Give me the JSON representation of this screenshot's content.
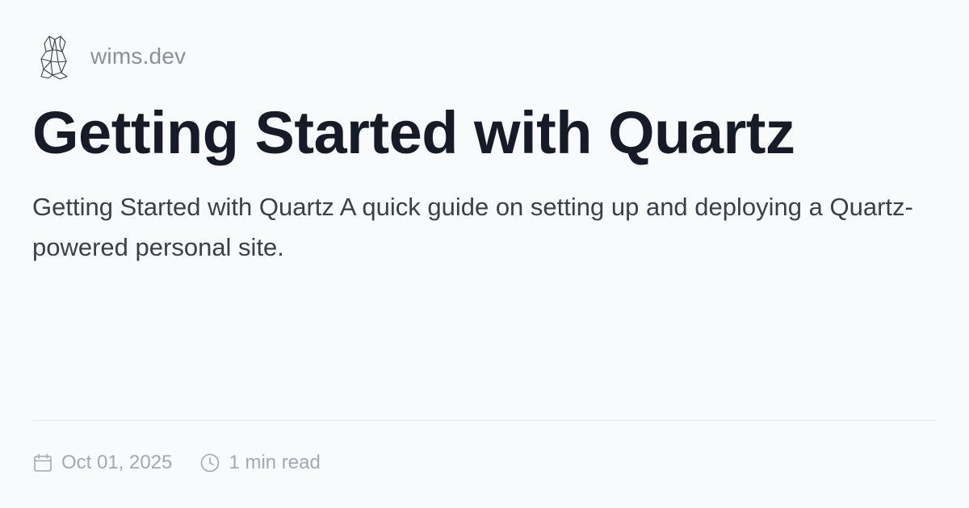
{
  "site": {
    "name": "wims.dev",
    "logo_icon": "crystal-logo-icon"
  },
  "post": {
    "title": "Getting Started with Quartz",
    "description": "Getting Started with Quartz A quick guide on setting up and deploying a Quartz-powered personal site.",
    "date": "Oct 01, 2025",
    "date_icon": "calendar-icon",
    "read_time": "1 min read",
    "read_time_icon": "clock-icon"
  },
  "colors": {
    "background": "#f9fafc",
    "title": "#161b27",
    "description": "#3a3f48",
    "muted": "#8a8f98",
    "meta": "#a3a8b1",
    "divider": "#e3e5ea"
  }
}
